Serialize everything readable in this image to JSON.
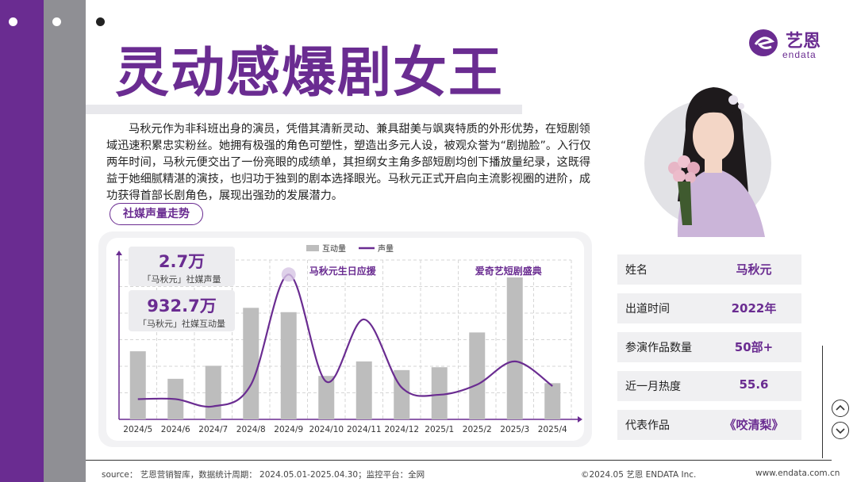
{
  "header": {
    "title": "灵动感爆剧女王"
  },
  "logo": {
    "cn": "艺恩",
    "en": "endata"
  },
  "intro": {
    "text": "马秋元作为非科班出身的演员，凭借其清新灵动、兼具甜美与飒爽特质的外形优势，在短剧领域迅速积累忠实粉丝。她拥有极强的角色可塑性，塑造出多元人设，被观众誉为“剧抛脸”。入行仅两年时间，马秋元便交出了一份亮眼的成绩单，其担纲女主角多部短剧均创下播放量纪录，这既得益于她细腻精湛的演技，也归功于独到的剧本选择眼光。马秋元正式开启向主流影视圈的进阶，成功获得首部长剧角色，展现出强劲的发展潜力。"
  },
  "section": {
    "label": "社媒声量走势"
  },
  "stats": {
    "voice_value": "2.7万",
    "voice_label": "「马秋元」社媒声量",
    "interact_value": "932.7万",
    "interact_label": "「马秋元」社媒互动量"
  },
  "chart_data": {
    "type": "bar",
    "categories": [
      "2024/5",
      "2024/6",
      "2024/7",
      "2024/8",
      "2024/9",
      "2024/10",
      "2024/11",
      "2024/12",
      "2025/1",
      "2025/2",
      "2025/3",
      "2025/4"
    ],
    "series": [
      {
        "name": "互动量",
        "type": "bar",
        "values": [
          47,
          28,
          37,
          77,
          74,
          30,
          40,
          34,
          36,
          60,
          98,
          25
        ]
      },
      {
        "name": "声量",
        "type": "line",
        "values": [
          14,
          14,
          9,
          24,
          100,
          26,
          69,
          22,
          17,
          24,
          40,
          23
        ]
      }
    ],
    "legend": "top-center",
    "annotations": [
      {
        "text": "马秋元生日应援",
        "at": "2024/9"
      },
      {
        "text": "爱奇艺短剧盛典",
        "at": "2025/3"
      }
    ],
    "ylim": [
      0,
      110
    ],
    "grid": true,
    "colors": {
      "bar": "#bdbdbd",
      "line": "#6a2c91",
      "grid": "#d6d6d6"
    }
  },
  "profile": {
    "rows": [
      {
        "key": "姓名",
        "value": "马秋元"
      },
      {
        "key": "出道时间",
        "value": "2022年"
      },
      {
        "key": "参演作品数量",
        "value": "50部+"
      },
      {
        "key": "近一月热度",
        "value": "55.6"
      },
      {
        "key": "代表作品",
        "value": "《咬清梨》"
      }
    ]
  },
  "nav": {
    "up": "^",
    "down": "v"
  },
  "footer": {
    "source": "source： 艺恩营销智库，数据统计周期： 2024.05.01-2025.04.30；监控平台：全网",
    "copyright": "©2024.05  艺恩  ENDATA Inc.",
    "url": "www.endata.com.cn"
  },
  "colors": {
    "brand": "#6a2c91",
    "sidebar_gray": "#8f8f94"
  }
}
